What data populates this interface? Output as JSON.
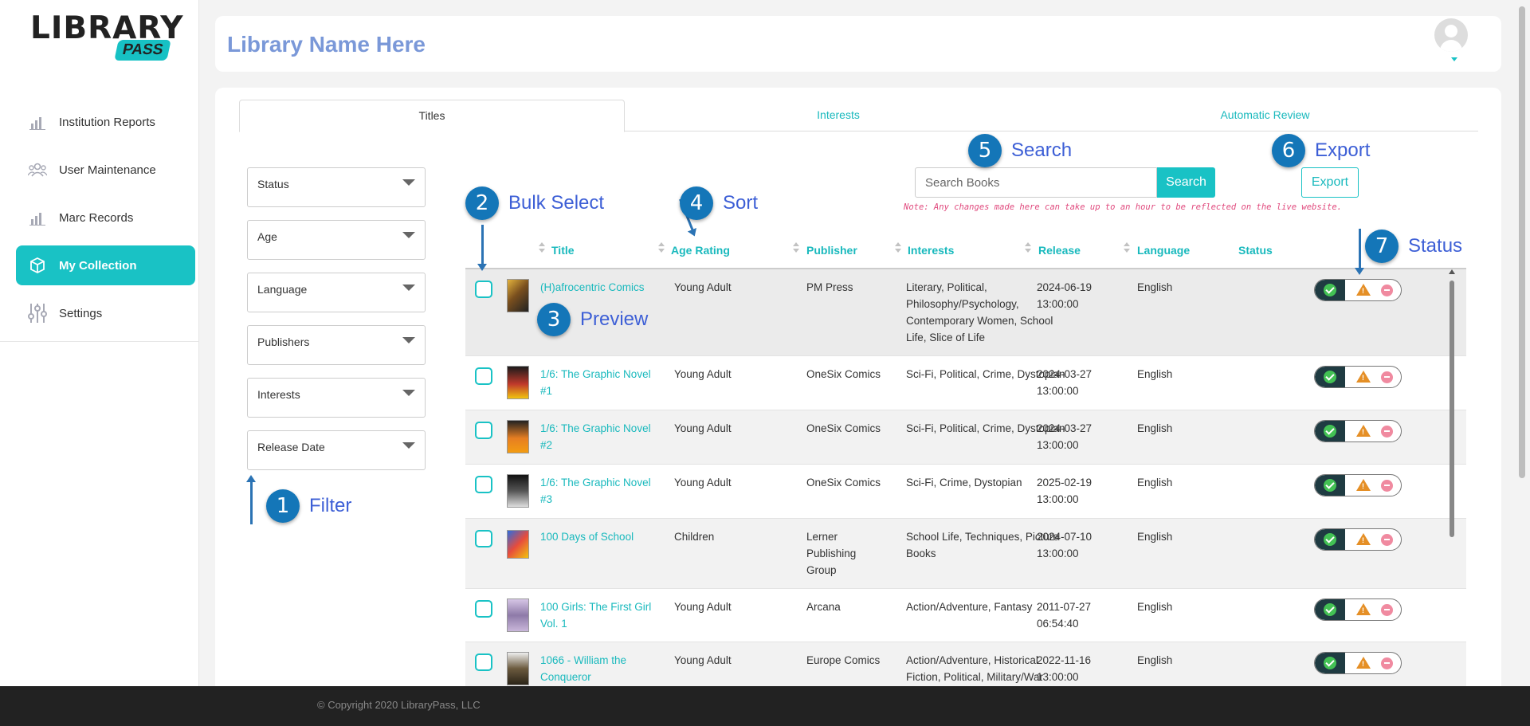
{
  "brand": {
    "logo_text": "LIBRARY",
    "logo_badge": "PASS"
  },
  "sidebar": {
    "items": [
      {
        "label": "Institution Reports",
        "icon": "bar-chart-icon"
      },
      {
        "label": "User Maintenance",
        "icon": "users-icon"
      },
      {
        "label": "Marc Records",
        "icon": "bar-chart-icon"
      },
      {
        "label": "My Collection",
        "icon": "box-icon",
        "active": true
      },
      {
        "label": "Settings",
        "icon": "sliders-icon"
      }
    ]
  },
  "header": {
    "library_name": "Library Name Here"
  },
  "tabs": [
    {
      "label": "Titles",
      "active": true
    },
    {
      "label": "Interests"
    },
    {
      "label": "Automatic Review"
    }
  ],
  "filters": [
    "Status",
    "Age",
    "Language",
    "Publishers",
    "Interests",
    "Release Date"
  ],
  "search": {
    "placeholder": "Search Books",
    "button": "Search"
  },
  "export": {
    "button": "Export"
  },
  "note": "Note: Any changes made here can take up to an hour to be reflected on the live website.",
  "table": {
    "columns": [
      "Title",
      "Age Rating",
      "Publisher",
      "Interests",
      "Release",
      "Language",
      "Status"
    ],
    "rows": [
      {
        "title": "(H)afrocentric Comics",
        "age": "Young Adult",
        "publisher": "PM Press",
        "interests": "Literary, Political, Philosophy/Psychology, Contemporary Women, School Life, Slice of Life",
        "release_date": "2024-06-19",
        "release_time": "13:00:00",
        "language": "English"
      },
      {
        "title": "1/6: The Graphic Novel #1",
        "age": "Young Adult",
        "publisher": "OneSix Comics",
        "interests": "Sci-Fi, Political, Crime, Dystopian",
        "release_date": "2024-03-27",
        "release_time": "13:00:00",
        "language": "English"
      },
      {
        "title": "1/6: The Graphic Novel #2",
        "age": "Young Adult",
        "publisher": "OneSix Comics",
        "interests": "Sci-Fi, Political, Crime, Dystopian",
        "release_date": "2024-03-27",
        "release_time": "13:00:00",
        "language": "English"
      },
      {
        "title": "1/6: The Graphic Novel #3",
        "age": "Young Adult",
        "publisher": "OneSix Comics",
        "interests": "Sci-Fi, Crime, Dystopian",
        "release_date": "2025-02-19",
        "release_time": "13:00:00",
        "language": "English"
      },
      {
        "title": "100 Days of School",
        "age": "Children",
        "publisher": "Lerner Publishing Group",
        "interests": "School Life, Techniques, Picture Books",
        "release_date": "2024-07-10",
        "release_time": "13:00:00",
        "language": "English"
      },
      {
        "title": "100 Girls: The First Girl Vol. 1",
        "age": "Young Adult",
        "publisher": "Arcana",
        "interests": "Action/Adventure, Fantasy",
        "release_date": "2011-07-27",
        "release_time": "06:54:40",
        "language": "English"
      },
      {
        "title": "1066 - William the Conqueror",
        "age": "Young Adult",
        "publisher": "Europe Comics",
        "interests": "Action/Adventure, Historical Fiction, Political, Military/War",
        "release_date": "2022-11-16",
        "release_time": "13:00:00",
        "language": "English"
      }
    ]
  },
  "annotations": [
    {
      "num": "1",
      "label": "Filter"
    },
    {
      "num": "2",
      "label": "Bulk Select"
    },
    {
      "num": "3",
      "label": "Preview"
    },
    {
      "num": "4",
      "label": "Sort"
    },
    {
      "num": "5",
      "label": "Search"
    },
    {
      "num": "6",
      "label": "Export"
    },
    {
      "num": "7",
      "label": "Status"
    }
  ],
  "footer": {
    "copyright": "© Copyright 2020 LibraryPass, LLC"
  },
  "colors": {
    "accent": "#19c2c5",
    "annotation": "#1476b8",
    "note": "#e0497d",
    "title": "#7a98d8"
  }
}
